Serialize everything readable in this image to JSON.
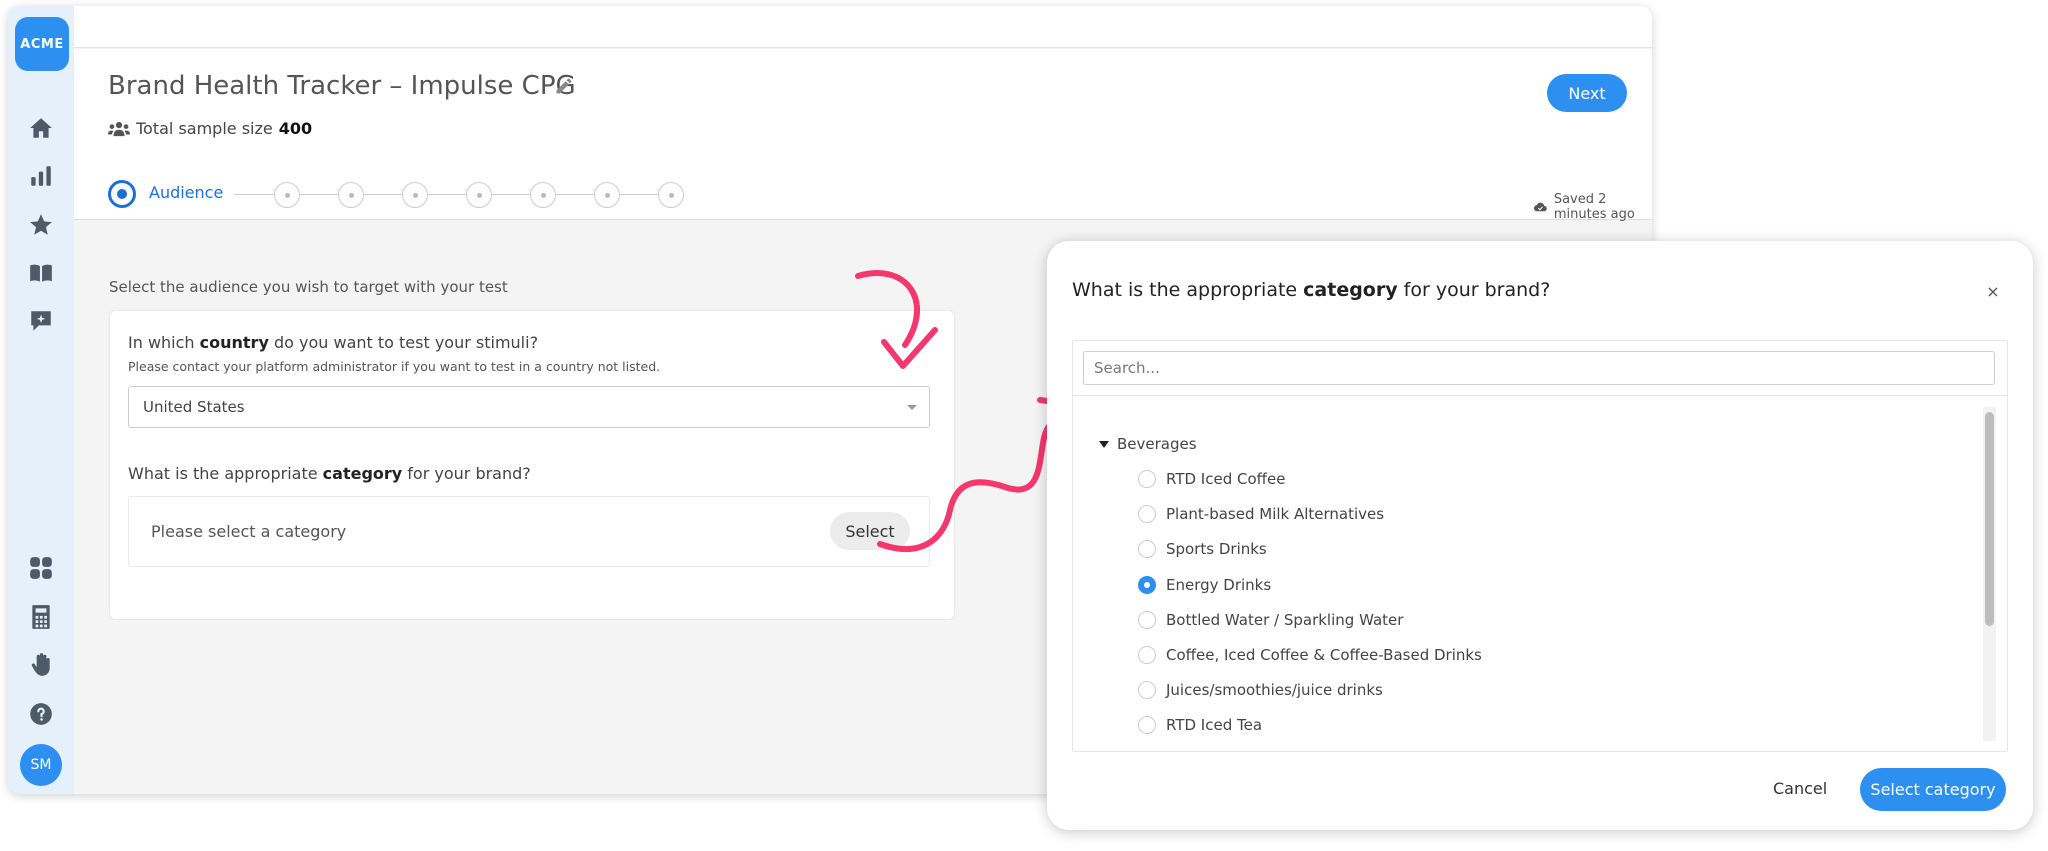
{
  "sidebar": {
    "logo": "ACME",
    "top_icons": [
      "home-icon",
      "bar-chart-icon",
      "star-icon",
      "book-icon",
      "chat-sparkle-icon"
    ],
    "bottom_icons": [
      "grid-icon",
      "calculator-icon",
      "hand-icon",
      "help-icon"
    ],
    "avatar": "SM"
  },
  "header": {
    "title": "Brand Health Tracker – Impulse CPG",
    "sample_label": "Total sample size",
    "sample_value": "400",
    "next_label": "Next",
    "saved_text": "Saved 2 minutes ago"
  },
  "stepper": {
    "active_label": "Audience",
    "inactive_steps": 7
  },
  "audience": {
    "instruction": "Select the audience you wish to target with your test",
    "country_q_pre": "In which ",
    "country_q_bold": "country",
    "country_q_post": " do you want to test your stimuli?",
    "country_help": "Please contact your platform administrator if you want to test in a country not listed.",
    "country_value": "United States",
    "category_q_pre": "What is the appropriate ",
    "category_q_bold": "category",
    "category_q_post": " for your brand?",
    "category_placeholder": "Please select a category",
    "select_label": "Select"
  },
  "modal": {
    "title_pre": "What is the appropriate ",
    "title_bold": "category",
    "title_post": " for your brand?",
    "close_label": "×",
    "search_placeholder": "Search...",
    "group": "Beverages",
    "options": [
      "RTD Iced Coffee",
      "Plant-based Milk Alternatives",
      "Sports Drinks",
      "Energy Drinks",
      "Bottled Water / Sparkling Water",
      "Coffee, Iced Coffee & Coffee-Based Drinks",
      "Juices/smoothies/juice drinks",
      "RTD Iced Tea"
    ],
    "selected_option": "Energy Drinks",
    "cancel_label": "Cancel",
    "confirm_label": "Select category"
  },
  "colors": {
    "accent": "#2d8ff0",
    "active_step": "#1d6fd8",
    "arrow": "#f2386e"
  }
}
